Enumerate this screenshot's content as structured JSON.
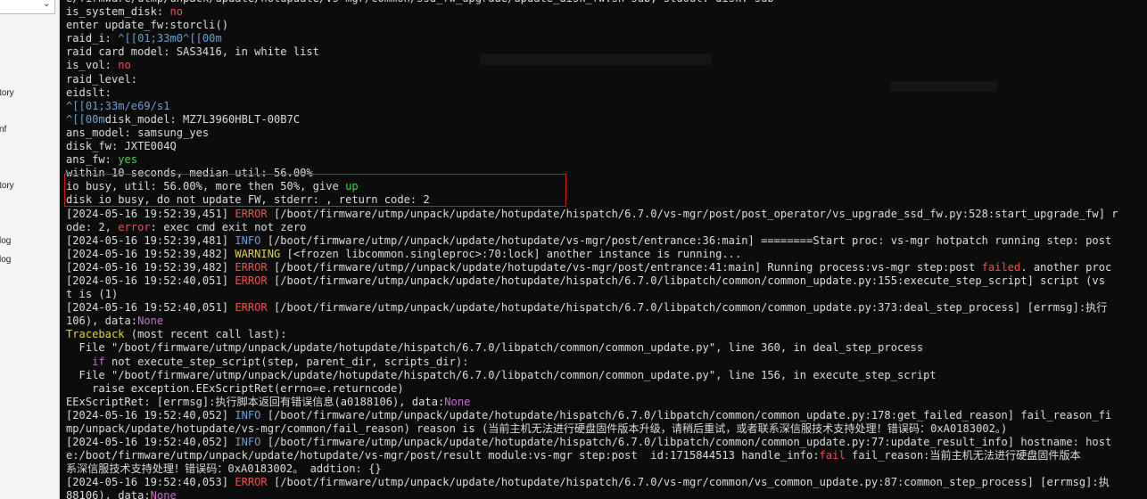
{
  "sidebar": {
    "items": [
      "tory",
      "nf",
      "tory",
      "log",
      "log"
    ]
  },
  "terminal": {
    "lines": [
      [
        {
          "t": "e/firmware/utmp/unpack/update/hotupdate/vs-mgr/common/ssd_fw_upgrade/update_disk_fw.sh sub, stdout: disk: sub",
          "c": "default"
        }
      ],
      [
        {
          "t": "is_system_disk: ",
          "c": "default"
        },
        {
          "t": "no",
          "c": "red"
        }
      ],
      [
        {
          "t": "enter update_fw:storcli()",
          "c": "default"
        }
      ],
      [
        {
          "t": "raid_i: ",
          "c": "default"
        },
        {
          "t": "^[[01;33m0^[[00m",
          "c": "blue"
        }
      ],
      [
        {
          "t": "raid card model: SAS3416, in white list",
          "c": "default"
        }
      ],
      [
        {
          "t": "is_vol: ",
          "c": "default"
        },
        {
          "t": "no",
          "c": "red"
        }
      ],
      [
        {
          "t": "raid_level:",
          "c": "default"
        }
      ],
      [
        {
          "t": "eidslt:",
          "c": "default"
        }
      ],
      [
        {
          "t": "^[[01;33m/e69/s1",
          "c": "blue"
        }
      ],
      [
        {
          "t": "^[[00m",
          "c": "blue"
        },
        {
          "t": "disk_model: MZ7L3960HBLT-00B7C",
          "c": "default"
        }
      ],
      [
        {
          "t": "ans_model: samsung_yes",
          "c": "default"
        }
      ],
      [
        {
          "t": "disk_fw: JXTE004Q",
          "c": "default"
        }
      ],
      [
        {
          "t": "ans_fw: ",
          "c": "default"
        },
        {
          "t": "yes",
          "c": "green"
        }
      ],
      [
        {
          "t": "within 10 seconds, median util: 56.00%",
          "c": "default"
        }
      ],
      [
        {
          "t": "io busy, util: 56.00%, more then 50%, give ",
          "c": "default"
        },
        {
          "t": "up",
          "c": "green"
        }
      ],
      [
        {
          "t": "disk io busy, do not update FW, stderr: , return code: 2",
          "c": "default"
        }
      ],
      [
        {
          "t": "[2024-05-16 19:52:39,451] ",
          "c": "default"
        },
        {
          "t": "ERROR",
          "c": "red"
        },
        {
          "t": " [/boot/firmware/utmp/unpack/update/hotupdate/hispatch/6.7.0/vs-mgr/post/post_operator/vs_upgrade_ssd_fw.py:528:start_upgrade_fw] r",
          "c": "default"
        }
      ],
      [
        {
          "t": "ode: 2, ",
          "c": "default"
        },
        {
          "t": "error",
          "c": "red"
        },
        {
          "t": ": exec cmd exit not zero",
          "c": "default"
        }
      ],
      [
        {
          "t": "[2024-05-16 19:52:39,481] ",
          "c": "default"
        },
        {
          "t": "INFO",
          "c": "blue"
        },
        {
          "t": " [/boot/firmware/utmp//unpack/update/hotupdate/vs-mgr/post/entrance:36:main] ========Start proc: vs-mgr hotpatch running step: post",
          "c": "default"
        }
      ],
      [
        {
          "t": "[2024-05-16 19:52:39,482] ",
          "c": "default"
        },
        {
          "t": "WARNING",
          "c": "yellow"
        },
        {
          "t": " [<frozen libcommon.singleproc>:70:lock] another instance is running...",
          "c": "default"
        }
      ],
      [
        {
          "t": "[2024-05-16 19:52:39,482] ",
          "c": "default"
        },
        {
          "t": "ERROR",
          "c": "red"
        },
        {
          "t": " [/boot/firmware/utmp//unpack/update/hotupdate/vs-mgr/post/entrance:41:main] Running process:vs-mgr step:post ",
          "c": "default"
        },
        {
          "t": "failed",
          "c": "red"
        },
        {
          "t": ". another proc",
          "c": "default"
        }
      ],
      [
        {
          "t": "[2024-05-16 19:52:40,051] ",
          "c": "default"
        },
        {
          "t": "ERROR",
          "c": "red"
        },
        {
          "t": " [/boot/firmware/utmp/unpack/update/hotupdate/hispatch/6.7.0/libpatch/common/common_update.py:155:execute_step_script] script (vs",
          "c": "default"
        }
      ],
      [
        {
          "t": "t is (1)",
          "c": "default"
        }
      ],
      [
        {
          "t": "[2024-05-16 19:52:40,051] ",
          "c": "default"
        },
        {
          "t": "ERROR",
          "c": "red"
        },
        {
          "t": " [/boot/firmware/utmp/unpack/update/hotupdate/hispatch/6.7.0/libpatch/common/common_update.py:373:deal_step_process] [errmsg]:执行",
          "c": "default"
        }
      ],
      [
        {
          "t": "106), data:",
          "c": "default"
        },
        {
          "t": "None",
          "c": "purple"
        }
      ],
      [
        {
          "t": "Traceback",
          "c": "yellow"
        },
        {
          "t": " (most recent call last):",
          "c": "default"
        }
      ],
      [
        {
          "t": "  File \"/boot/firmware/utmp/unpack/update/hotupdate/hispatch/6.7.0/libpatch/common/common_update.py\", line 360, in deal_step_process",
          "c": "default"
        }
      ],
      [
        {
          "t": "    ",
          "c": "default"
        },
        {
          "t": "if",
          "c": "purple"
        },
        {
          "t": " not execute_step_script(step, parent_dir, scripts_dir):",
          "c": "default"
        }
      ],
      [
        {
          "t": "  File \"/boot/firmware/utmp/unpack/update/hotupdate/hispatch/6.7.0/libpatch/common/common_update.py\", line 156, in execute_step_script",
          "c": "default"
        }
      ],
      [
        {
          "t": "    raise exception.EExScriptRet(errno=e.returncode)",
          "c": "default"
        }
      ],
      [
        {
          "t": "EExScriptRet: [errmsg]:执行脚本返回有错误信息(a0188106), data:",
          "c": "default"
        },
        {
          "t": "None",
          "c": "purple"
        }
      ],
      [
        {
          "t": "[2024-05-16 19:52:40,052] ",
          "c": "default"
        },
        {
          "t": "INFO",
          "c": "blue"
        },
        {
          "t": " [/boot/firmware/utmp/unpack/update/hotupdate/hispatch/6.7.0/libpatch/common/common_update.py:178:get_failed_reason] fail_reason_fi",
          "c": "default"
        }
      ],
      [
        {
          "t": "mp/unpack/update/hotupdate/vs-mgr/common/fail_reason) reason is (当前主机无法进行硬盘固件版本升级，请稍后重试，或者联系深信服技术支持处理！错误码：0xA0183002。)",
          "c": "default"
        }
      ],
      [
        {
          "t": "[2024-05-16 19:52:40,052] ",
          "c": "default"
        },
        {
          "t": "INFO",
          "c": "blue"
        },
        {
          "t": " [/boot/firmware/utmp/unpack/update/hotupdate/hispatch/6.7.0/libpatch/common/common_update.py:77:update_result_info] hostname: host",
          "c": "default"
        }
      ],
      [
        {
          "t": "e:/boot/firmware/utmp/unpack/update/hotupdate/vs-mgr/post/result module:vs-mgr step:post  id:1715844513 handle_info:",
          "c": "default"
        },
        {
          "t": "fail",
          "c": "red"
        },
        {
          "t": " fail_reason:当前主机无法进行硬盘固件版本",
          "c": "default"
        }
      ],
      [
        {
          "t": "系深信服技术支持处理！错误码：0xA0183002。 addtion: {}",
          "c": "default"
        }
      ],
      [
        {
          "t": "[2024-05-16 19:52:40,053] ",
          "c": "default"
        },
        {
          "t": "ERROR",
          "c": "red"
        },
        {
          "t": " [/boot/firmware/utmp/unpack/update/hotupdate/hispatch/6.7.0/vs-mgr/common/vs_common_update.py:87:common_step_process] [errmsg]:执",
          "c": "default"
        }
      ],
      [
        {
          "t": "88106), data:",
          "c": "default"
        },
        {
          "t": "None",
          "c": "purple"
        }
      ]
    ]
  }
}
